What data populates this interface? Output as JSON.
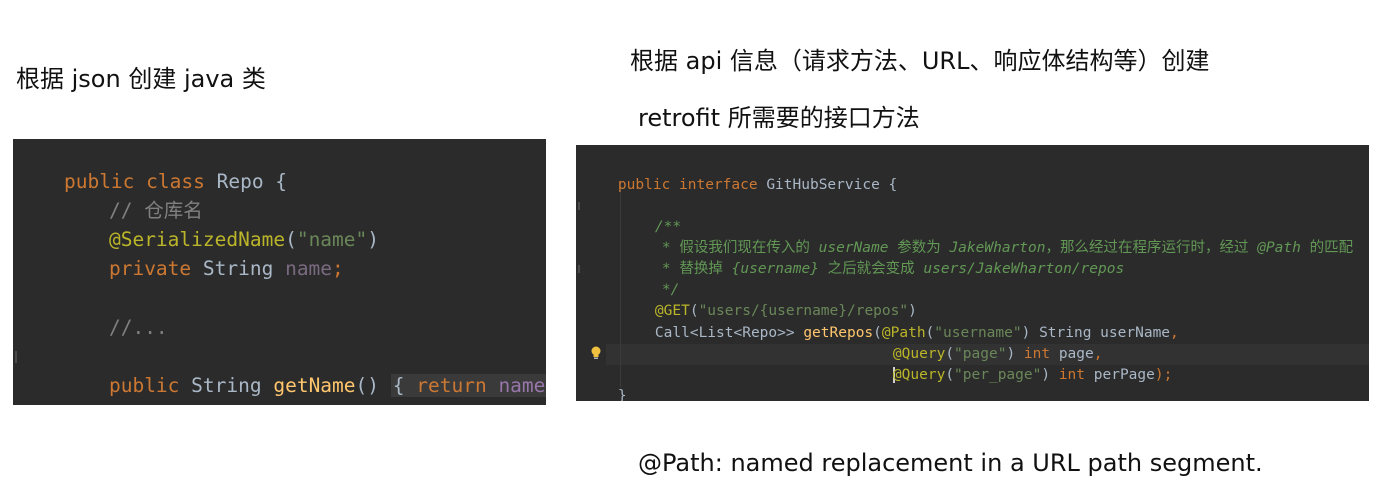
{
  "captions": {
    "left": "根据 json 创建 java 类",
    "right_line1": "根据 api 信息（请求方法、URL、响应体结构等）创建",
    "right_line2": "retrofit 所需要的接口方法",
    "bottom": "@Path: named replacement in a URL path segment."
  },
  "left_code": {
    "l1_kw": "public class ",
    "l1_name": "Repo {",
    "l2_comment": "// 仓库名",
    "l3_ann": "@SerializedName",
    "l3_open": "(",
    "l3_str": "\"name\"",
    "l3_close": ")",
    "l4_kw": "private ",
    "l4_type": "String ",
    "l4_field": "name",
    "l4_semi": ";",
    "l6_comment": "//...",
    "l8_kw": "public ",
    "l8_type": "String ",
    "l8_fn": "getName",
    "l8_parens": "() ",
    "l8_lbrace": "{ ",
    "l8_return": "return ",
    "l8_field": "name",
    "l8_semi": ";",
    "l8_rbrace": " }",
    "l9_close": "}"
  },
  "right_code": {
    "l1_kw": "public interface ",
    "l1_name": "GitHubService {",
    "doc_open": "/**",
    "doc1_a": "* 假设我们现在传入的 ",
    "doc1_b": "userName",
    "doc1_c": " 参数为 ",
    "doc1_d": "JakeWharton",
    "doc1_e": "，那么经过在程序运行时，经过 ",
    "doc1_f": "@Path",
    "doc1_g": " 的匹配",
    "doc2_a": "* 替换掉 ",
    "doc2_b": "{username}",
    "doc2_c": " 之后就会变成 ",
    "doc2_d": "users/JakeWharton/repos",
    "doc_close": "*/",
    "get_ann": "@GET",
    "get_open": "(",
    "get_str": "\"users/{username}/repos\"",
    "get_close": ")",
    "m_type": "Call<List<Repo>> ",
    "m_fn": "getRepos",
    "m_open": "(",
    "p1_ann": "@Path",
    "p1_open": "(",
    "p1_str": "\"username\"",
    "p1_close": ") ",
    "p1_type": "String userName",
    "p1_comma": ",",
    "p2_ann": "@Query",
    "p2_open": "(",
    "p2_str": "\"page\"",
    "p2_close": ") ",
    "p2_kw": "int ",
    "p2_name": "page",
    "p2_comma": ",",
    "p3_ann_a": "@",
    "p3_ann_b": "Query",
    "p3_open": "(",
    "p3_str": "\"per_page\"",
    "p3_close": ") ",
    "p3_kw": "int ",
    "p3_name": "perPage",
    "p3_end": ");",
    "close": "}"
  },
  "colors": {
    "background": "#2b2b2b",
    "keyword": "#cc7832",
    "string": "#6a8759",
    "annotation": "#bbb529",
    "function": "#ffc66d",
    "field": "#9876aa",
    "comment": "#808080",
    "doc_comment": "#629755",
    "plain": "#a9b7c6"
  },
  "icons": {
    "bulb": "lightbulb-icon"
  }
}
